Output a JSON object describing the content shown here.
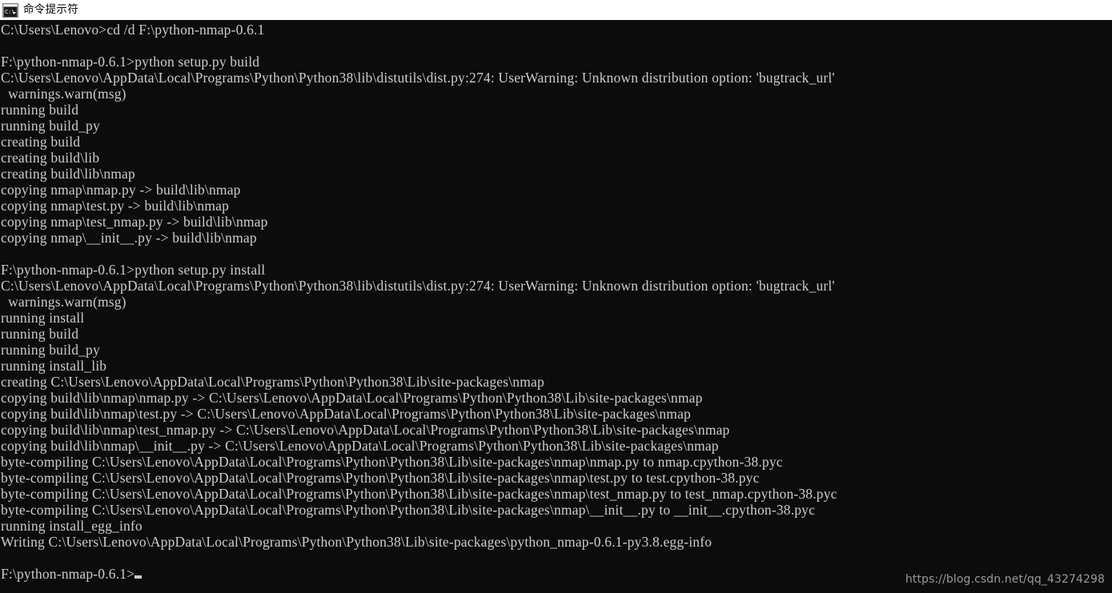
{
  "window": {
    "title": "命令提示符",
    "icon": "command-prompt-icon",
    "background_color": "#0c0c0c",
    "text_color": "#ccccce",
    "titlebar_color": "#ffffff"
  },
  "console": {
    "cursor": "block-cursor",
    "lines": [
      "C:\\Users\\Lenovo>cd /d F:\\python-nmap-0.6.1",
      "",
      "F:\\python-nmap-0.6.1>python setup.py build",
      "C:\\Users\\Lenovo\\AppData\\Local\\Programs\\Python\\Python38\\lib\\distutils\\dist.py:274: UserWarning: Unknown distribution option: 'bugtrack_url'",
      "  warnings.warn(msg)",
      "running build",
      "running build_py",
      "creating build",
      "creating build\\lib",
      "creating build\\lib\\nmap",
      "copying nmap\\nmap.py -> build\\lib\\nmap",
      "copying nmap\\test.py -> build\\lib\\nmap",
      "copying nmap\\test_nmap.py -> build\\lib\\nmap",
      "copying nmap\\__init__.py -> build\\lib\\nmap",
      "",
      "F:\\python-nmap-0.6.1>python setup.py install",
      "C:\\Users\\Lenovo\\AppData\\Local\\Programs\\Python\\Python38\\lib\\distutils\\dist.py:274: UserWarning: Unknown distribution option: 'bugtrack_url'",
      "  warnings.warn(msg)",
      "running install",
      "running build",
      "running build_py",
      "running install_lib",
      "creating C:\\Users\\Lenovo\\AppData\\Local\\Programs\\Python\\Python38\\Lib\\site-packages\\nmap",
      "copying build\\lib\\nmap\\nmap.py -> C:\\Users\\Lenovo\\AppData\\Local\\Programs\\Python\\Python38\\Lib\\site-packages\\nmap",
      "copying build\\lib\\nmap\\test.py -> C:\\Users\\Lenovo\\AppData\\Local\\Programs\\Python\\Python38\\Lib\\site-packages\\nmap",
      "copying build\\lib\\nmap\\test_nmap.py -> C:\\Users\\Lenovo\\AppData\\Local\\Programs\\Python\\Python38\\Lib\\site-packages\\nmap",
      "copying build\\lib\\nmap\\__init__.py -> C:\\Users\\Lenovo\\AppData\\Local\\Programs\\Python\\Python38\\Lib\\site-packages\\nmap",
      "byte-compiling C:\\Users\\Lenovo\\AppData\\Local\\Programs\\Python\\Python38\\Lib\\site-packages\\nmap\\nmap.py to nmap.cpython-38.pyc",
      "byte-compiling C:\\Users\\Lenovo\\AppData\\Local\\Programs\\Python\\Python38\\Lib\\site-packages\\nmap\\test.py to test.cpython-38.pyc",
      "byte-compiling C:\\Users\\Lenovo\\AppData\\Local\\Programs\\Python\\Python38\\Lib\\site-packages\\nmap\\test_nmap.py to test_nmap.cpython-38.pyc",
      "byte-compiling C:\\Users\\Lenovo\\AppData\\Local\\Programs\\Python\\Python38\\Lib\\site-packages\\nmap\\__init__.py to __init__.cpython-38.pyc",
      "running install_egg_info",
      "Writing C:\\Users\\Lenovo\\AppData\\Local\\Programs\\Python\\Python38\\Lib\\site-packages\\python_nmap-0.6.1-py3.8.egg-info",
      ""
    ],
    "prompt_line": "F:\\python-nmap-0.6.1>"
  },
  "watermark": {
    "text": "https://blog.csdn.net/qq_43274298"
  }
}
